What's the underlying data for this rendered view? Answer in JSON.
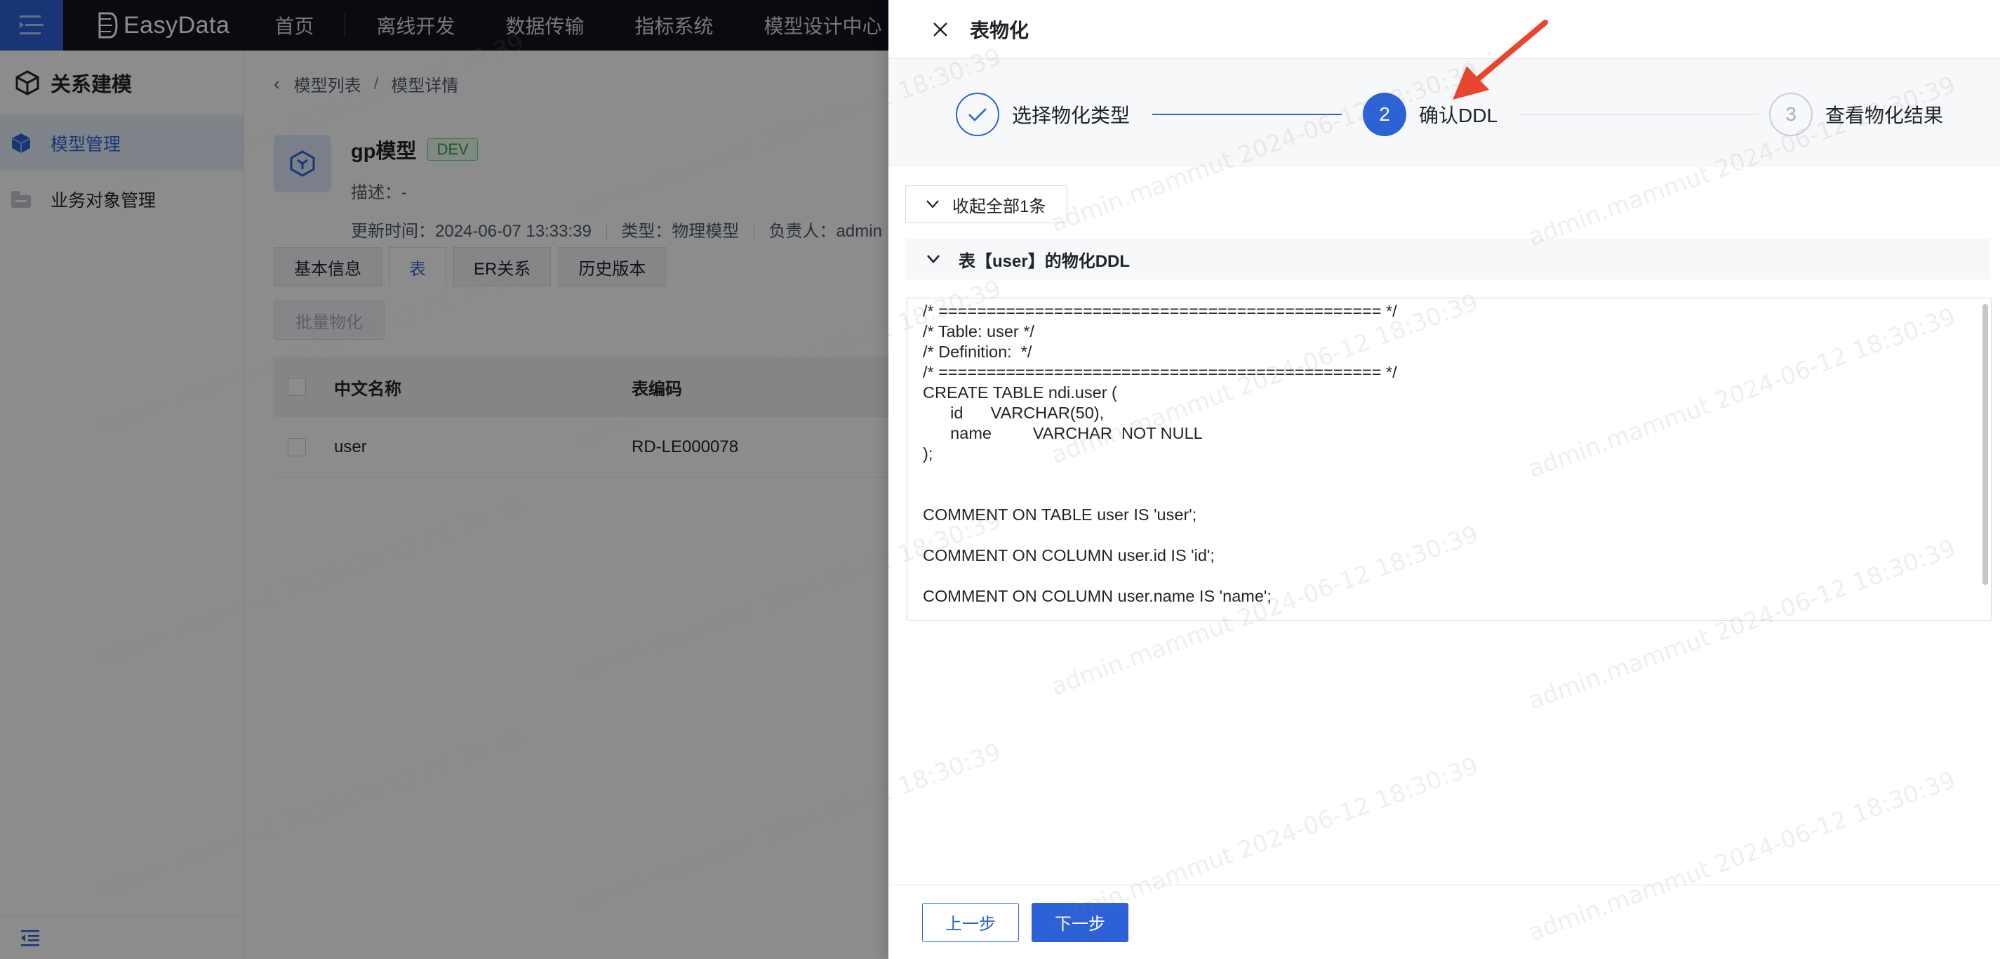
{
  "topnav": {
    "logo_text": "EasyData",
    "items": [
      "首页",
      "离线开发",
      "数据传输",
      "指标系统",
      "模型设计中心"
    ]
  },
  "sidebar": {
    "title": "关系建模",
    "items": [
      {
        "label": "模型管理",
        "active": true
      },
      {
        "label": "业务对象管理",
        "active": false
      }
    ]
  },
  "main": {
    "breadcrumb": [
      "模型列表",
      "模型详情"
    ],
    "model": {
      "name": "gp模型",
      "env_tag": "DEV",
      "desc_label": "描述：",
      "desc_value": "-",
      "updated_label": "更新时间：",
      "updated_value": "2024-06-07 13:33:39",
      "type_label": "类型：",
      "type_value": "物理模型",
      "owner_label": "负责人：",
      "owner_value": "admin"
    },
    "tabs": [
      "基本信息",
      "表",
      "ER关系",
      "历史版本"
    ],
    "active_tab": "表",
    "batch_button": "批量物化",
    "table": {
      "columns": [
        "中文名称",
        "表编码"
      ],
      "rows": [
        [
          "user",
          "RD-LE000078"
        ]
      ]
    }
  },
  "drawer": {
    "title": "表物化",
    "steps": [
      {
        "number": "1",
        "label": "选择物化类型",
        "status": "done"
      },
      {
        "number": "2",
        "label": "确认DDL",
        "status": "current"
      },
      {
        "number": "3",
        "label": "查看物化结果",
        "status": "pending"
      }
    ],
    "collapse_all": "收起全部1条",
    "panel_title": "表【user】的物化DDL",
    "ddl_lines": [
      "/* ============================================== */",
      "/* Table: user */",
      "/* Definition:  */",
      "/* ============================================== */",
      "CREATE TABLE ndi.user (",
      "      id      VARCHAR(50),",
      "      name         VARCHAR  NOT NULL",
      ");",
      "",
      "",
      "COMMENT ON TABLE user IS 'user';",
      "",
      "COMMENT ON COLUMN user.id IS 'id';",
      "",
      "COMMENT ON COLUMN user.name IS 'name';"
    ],
    "prev_button": "上一步",
    "next_button": "下一步"
  },
  "watermark_text": "admin.mammut 2024-06-12 18:30:39",
  "colors": {
    "primary": "#2c62d6",
    "nav_bg": "#12141f",
    "dev_tag": "#2ea043",
    "annotation_arrow": "#e8442e"
  }
}
